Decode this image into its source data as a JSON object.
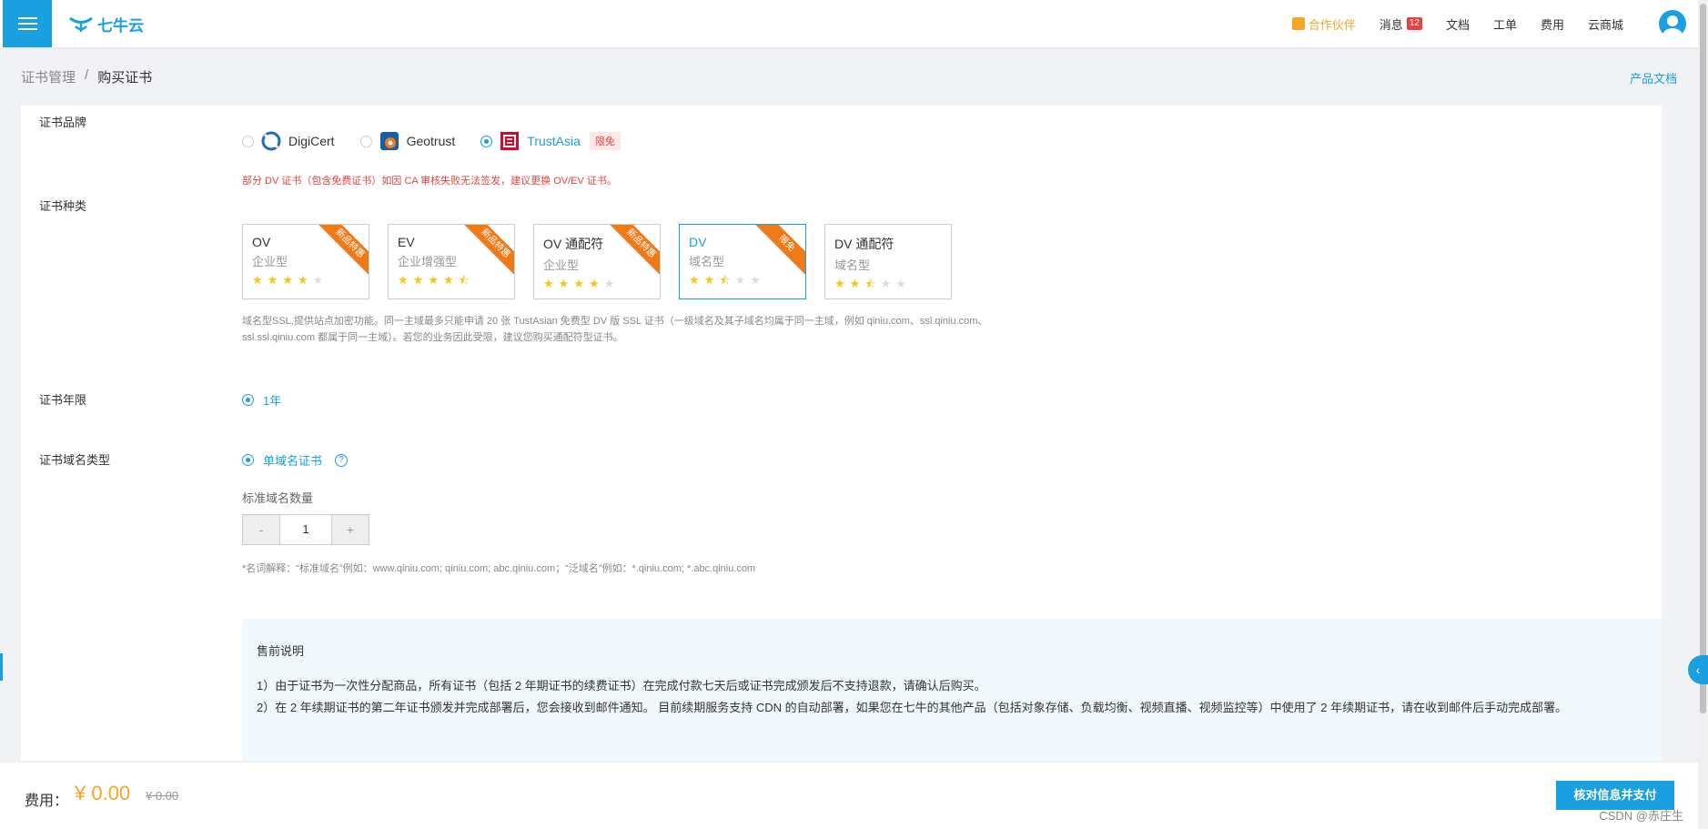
{
  "nav": {
    "brand": "七牛云",
    "items": [
      {
        "key": "partner",
        "label": "合作伙伴"
      },
      {
        "key": "messages",
        "label": "消息",
        "badge": "12"
      },
      {
        "key": "docs",
        "label": "文档"
      },
      {
        "key": "ticket",
        "label": "工单"
      },
      {
        "key": "billing",
        "label": "费用"
      },
      {
        "key": "market",
        "label": "云商城"
      }
    ]
  },
  "breadcrumb": {
    "parent": "证书管理",
    "sep": "/",
    "current": "购买证书"
  },
  "doc_link": "产品文档",
  "form": {
    "brand_label": "证书品牌",
    "brands": [
      {
        "name": "DigiCert",
        "selected": false
      },
      {
        "name": "Geotrust",
        "selected": false
      },
      {
        "name": "TrustAsia",
        "selected": true,
        "tag": "限免"
      }
    ],
    "brand_warning": "部分 DV 证书（包含免费证书）如因 CA 审核失败无法签发，建议更换 OV/EV 证书。",
    "type_label": "证书种类",
    "types": [
      {
        "name": "OV",
        "sub": "企业型",
        "rating": 4,
        "ribbon": "新品特惠",
        "selected": false
      },
      {
        "name": "EV",
        "sub": "企业增强型",
        "rating": 4.5,
        "ribbon": "新品特惠",
        "selected": false
      },
      {
        "name": "OV 通配符",
        "sub": "企业型",
        "rating": 4,
        "ribbon": "新品特惠",
        "selected": false
      },
      {
        "name": "DV",
        "sub": "域名型",
        "rating": 2.5,
        "ribbon": "限免",
        "selected": true
      },
      {
        "name": "DV 通配符",
        "sub": "域名型",
        "rating": 2.5,
        "ribbon": "",
        "selected": false
      }
    ],
    "type_desc": "域名型SSL,提供站点加密功能。同一主域最多只能申请 20 张 TustAsian 免费型 DV 版 SSL 证书（一级域名及其子域名均属于同一主域，例如 qiniu.com、ssl.qiniu.com、ssl.ssl.qiniu.com 都属于同一主域）。若您的业务因此受限，建议您购买通配符型证书。",
    "year_label": "证书年限",
    "year_value": "1年",
    "domain_type_label": "证书域名类型",
    "domain_type_value": "单域名证书",
    "qty_label": "标准域名数量",
    "qty_minus": "-",
    "qty_value": "1",
    "qty_plus": "+",
    "glossary": "*名词解释：“标准域名”例如：www.qiniu.com; qiniu.com; abc.qiniu.com；“泛域名”例如：*.qiniu.com; *.abc.qiniu.com"
  },
  "presale": {
    "title": "售前说明",
    "items": [
      "1）由于证书为一次性分配商品，所有证书（包括 2 年期证书的续费证书）在完成付款七天后或证书完成颁发后不支持退款，请确认后购买。",
      "2）在 2 年续期证书的第二年证书颁发并完成部署后，您会接收到邮件通知。 目前续期服务支持 CDN 的自动部署，如果您在七牛的其他产品（包括对象存储、负载均衡、视频直播、视频监控等）中使用了 2 年续期证书，请在收到邮件后手动完成部署。"
    ]
  },
  "footer": {
    "fee_label": "费用：",
    "fee_value": "¥ 0.00",
    "fee_original": "¥ 0.00",
    "pay_button": "核对信息并支付",
    "watermark": "CSDN @赤庄生"
  },
  "colors": {
    "accent": "#1a9fe0",
    "warning": "#e64340",
    "ribbon": "#f07a18",
    "price": "#f5a623"
  }
}
